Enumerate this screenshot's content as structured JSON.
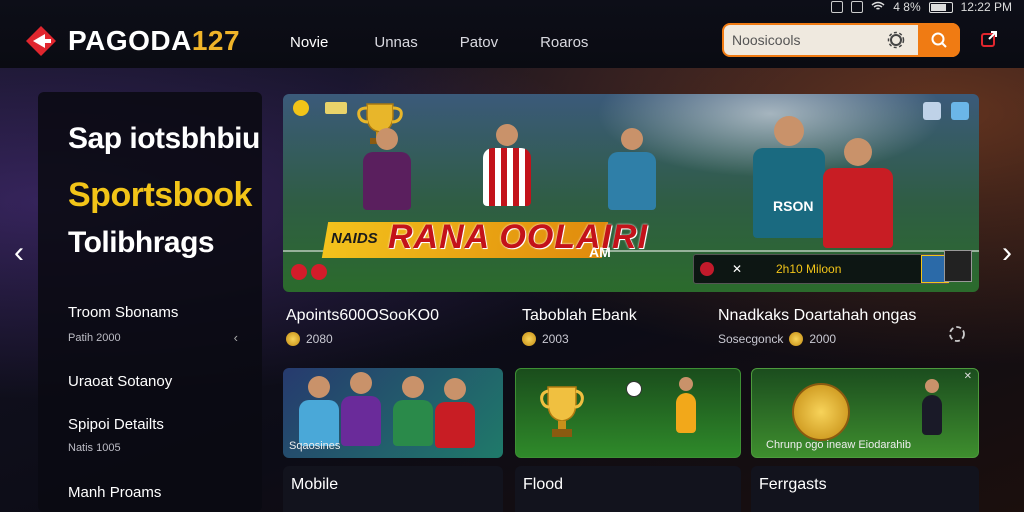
{
  "status": {
    "time": "12:22 PM",
    "battery": "4 8%"
  },
  "brand": {
    "name": "PAGODA",
    "number": "127"
  },
  "nav": [
    "Novie",
    "Unnas",
    "Patov",
    "Roaros"
  ],
  "search": {
    "placeholder": "Noosicools"
  },
  "sidebar": {
    "title_1": "Sap iotsbhbiu",
    "title_2": "Sportsbook",
    "title_3": "Tolibhrags",
    "items": [
      {
        "label": "Troom Sbonams",
        "sub": "Patih 2000"
      },
      {
        "label": "Uraoat Sotanoy",
        "sub": ""
      },
      {
        "label": "Spipoi Detailts",
        "sub": "Natis 1005"
      },
      {
        "label": "Manh Proams",
        "sub": ""
      }
    ]
  },
  "hero": {
    "title": "RANA OOLAIRI",
    "tag": "NAIDS",
    "tag_suffix": "AM",
    "info_text": "2h10 Miloon",
    "brand_text": "RSON"
  },
  "columns": [
    {
      "title": "Apoints600OSooKO0",
      "sub": "2080"
    },
    {
      "title": "Taboblah Ebank",
      "sub": "2003"
    },
    {
      "title": "Nnadkaks Doartahah ongas",
      "sub_prefix": "Sosecgonck",
      "sub": "2000"
    }
  ],
  "cards": [
    {
      "label": "Sqaosines"
    },
    {
      "label": ""
    },
    {
      "label": "Chrunp ogo ineaw Eiodarahib"
    }
  ],
  "bottom_cards": [
    "Mobile",
    "Flood",
    "Ferrgasts"
  ],
  "colors": {
    "accent": "#f07b13",
    "gold": "#f2c418",
    "red": "#c3121a"
  }
}
